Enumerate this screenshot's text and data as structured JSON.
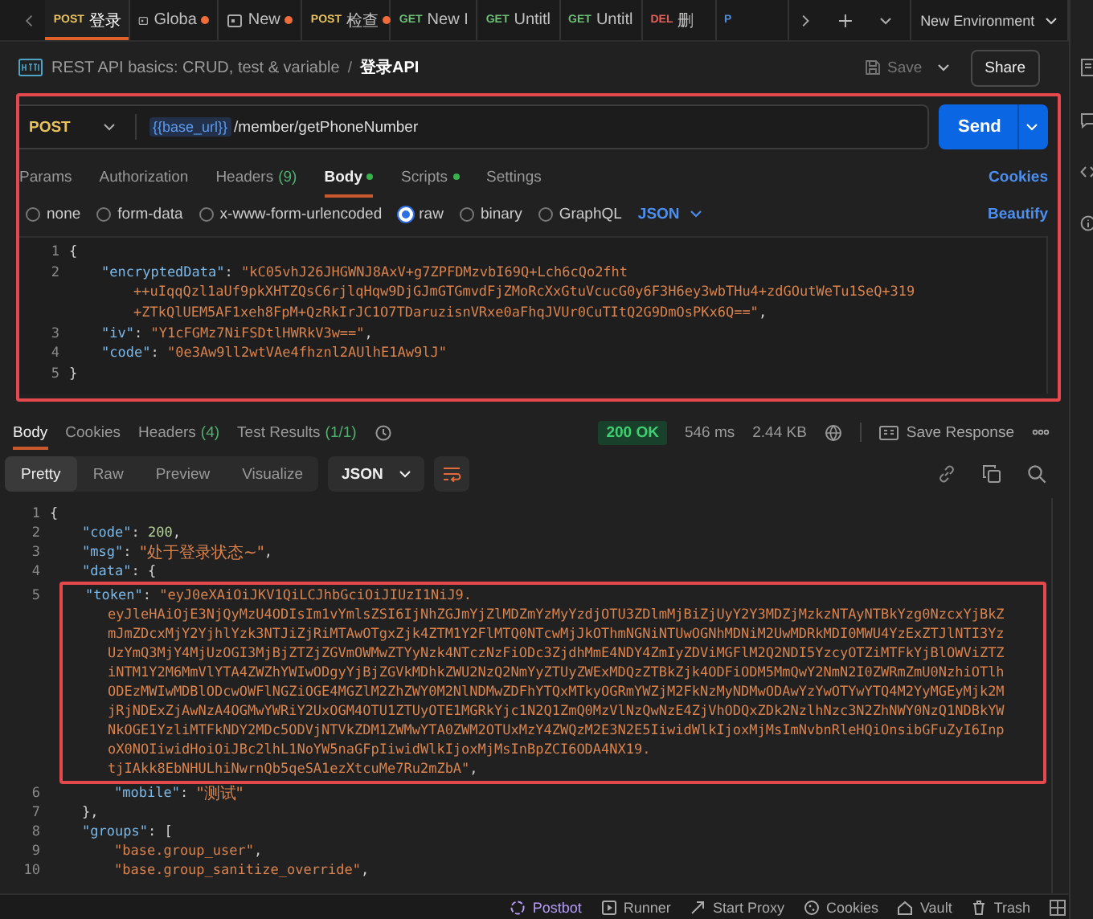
{
  "tabs": [
    {
      "kind": "request",
      "method": "POST",
      "color": "#e8c25c",
      "name": "登录",
      "unsaved": false,
      "selected": true
    },
    {
      "kind": "environment",
      "name": "Globa",
      "unsaved": true,
      "selected": false
    },
    {
      "kind": "environment",
      "name": "New",
      "unsaved": true,
      "selected": false
    },
    {
      "kind": "request",
      "method": "POST",
      "color": "#e8c25c",
      "name": "检查",
      "unsaved": true,
      "selected": false
    },
    {
      "kind": "request",
      "method": "GET",
      "color": "#6bbf74",
      "name": "New I",
      "unsaved": false,
      "selected": false
    },
    {
      "kind": "request",
      "method": "GET",
      "color": "#6bbf74",
      "name": "Untitl",
      "unsaved": false,
      "selected": false
    },
    {
      "kind": "request",
      "method": "GET",
      "color": "#6bbf74",
      "name": "Untitl",
      "unsaved": false,
      "selected": false
    },
    {
      "kind": "request",
      "method": "DEL",
      "color": "#e0605a",
      "name": "删",
      "unsaved": false,
      "selected": false
    },
    {
      "kind": "request",
      "method": "P",
      "color": "#4f8bd6",
      "unsaved": false,
      "selected": false
    }
  ],
  "environment": "New Environment",
  "breadcrumb": {
    "collection": "REST API basics: CRUD, test & variable",
    "separator": "/",
    "request": "登录API"
  },
  "save": "Save",
  "share": "Share",
  "request": {
    "method": "POST",
    "url_variable": "{{base_url}}",
    "url_path": "/member/getPhoneNumber",
    "send": "Send"
  },
  "request_tabs": [
    {
      "label": "Params",
      "selected": false,
      "dot": false
    },
    {
      "label": "Authorization",
      "selected": false,
      "dot": false
    },
    {
      "label": "Headers",
      "count": "(9)",
      "selected": false,
      "dot": false
    },
    {
      "label": "Body",
      "selected": true,
      "dot": true
    },
    {
      "label": "Scripts",
      "selected": false,
      "dot": true
    },
    {
      "label": "Settings",
      "selected": false,
      "dot": false
    }
  ],
  "cookies_link": "Cookies",
  "body_types": [
    {
      "label": "none",
      "selected": false
    },
    {
      "label": "form-data",
      "selected": false
    },
    {
      "label": "x-www-form-urlencoded",
      "selected": false
    },
    {
      "label": "raw",
      "selected": true
    },
    {
      "label": "binary",
      "selected": false
    },
    {
      "label": "GraphQL",
      "selected": false
    }
  ],
  "body_format": "JSON",
  "beautify": "Beautify",
  "request_body": [
    {
      "num": "1",
      "tokens": [
        {
          "kind": "open",
          "text": "{"
        }
      ]
    },
    {
      "num": "2",
      "tokens": [
        {
          "kind": "key",
          "text": "\"encryptedData\""
        },
        {
          "kind": "punct",
          "text": ": "
        },
        {
          "kind": "string",
          "text": "\"kC05vhJ26JHGWNJ8AxV+g7ZPFDMzvbI69Q+Lch6cQo2fht"
        }
      ],
      "wrap": [
        [
          {
            "kind": "string",
            "text": "++uIqqQzl1aUf9pkXHTZQsC6rjlqHqw9DjGJmGTGmvdFjZMoRcXxGtuVcucG0y6F3H6ey3wbTHu4+zdGOutWeTu1SeQ+319"
          }
        ],
        [
          {
            "kind": "string",
            "text": "+ZTkQlUEM5AF1xeh8FpM+QzRkIrJC1O7TDaruzisnVRxe0aFhqJVUr0CuTItQ2G9DmOsPKx6Q==\""
          },
          {
            "kind": "punct",
            "text": ","
          }
        ]
      ]
    },
    {
      "num": "3",
      "tokens": [
        {
          "kind": "key",
          "text": "\"iv\""
        },
        {
          "kind": "punct",
          "text": ": "
        },
        {
          "kind": "string",
          "text": "\"Y1cFGMz7NiFSDtlHWRkV3w==\""
        },
        {
          "kind": "punct",
          "text": ","
        }
      ]
    },
    {
      "num": "4",
      "tokens": [
        {
          "kind": "key",
          "text": "\"code\""
        },
        {
          "kind": "punct",
          "text": ": "
        },
        {
          "kind": "string",
          "text": "\"0e3Aw9ll2wtVAe4fhznl2AUlhE1Aw9lJ\""
        }
      ]
    },
    {
      "num": "5",
      "tokens": [
        {
          "kind": "close",
          "text": "}"
        }
      ]
    }
  ],
  "response": {
    "tabs": [
      {
        "label": "Body",
        "selected": true
      },
      {
        "label": "Cookies",
        "selected": false
      },
      {
        "label": "Headers",
        "count": "(4)",
        "selected": false
      },
      {
        "label": "Test Results",
        "count": "(1/1)",
        "selected": false
      }
    ],
    "status": "200 OK",
    "time": "546 ms",
    "size": "2.44 KB",
    "save_response": "Save Response",
    "views": [
      {
        "label": "Pretty",
        "selected": true
      },
      {
        "label": "Raw",
        "selected": false
      },
      {
        "label": "Preview",
        "selected": false
      },
      {
        "label": "Visualize",
        "selected": false
      }
    ],
    "format": "JSON",
    "body": [
      {
        "num": "1",
        "tokens": [
          {
            "kind": "open",
            "text": "{"
          }
        ]
      },
      {
        "num": "2",
        "tokens": [
          {
            "kind": "key",
            "text": "\"code\""
          },
          {
            "kind": "punct",
            "text": ": "
          },
          {
            "kind": "number",
            "text": "200"
          },
          {
            "kind": "punct",
            "text": ","
          }
        ]
      },
      {
        "num": "3",
        "tokens": [
          {
            "kind": "key",
            "text": "\"msg\""
          },
          {
            "kind": "punct",
            "text": ": "
          },
          {
            "kind": "string",
            "text": "\"处于登录状态~\""
          },
          {
            "kind": "punct",
            "text": ","
          }
        ]
      },
      {
        "num": "4",
        "tokens": [
          {
            "kind": "key",
            "text": "\"data\""
          },
          {
            "kind": "punct",
            "text": ": "
          },
          {
            "kind": "open",
            "text": "{"
          }
        ]
      },
      {
        "num": "5",
        "highlighted": true,
        "tokens": [
          {
            "kind": "key",
            "text": "\"token\""
          },
          {
            "kind": "punct",
            "text": ": "
          },
          {
            "kind": "string",
            "text": "\"eyJ0eXAiOiJKV1QiLCJhbGciOiJIUzI1NiJ9."
          }
        ],
        "wrap": [
          [
            {
              "kind": "string",
              "text": "eyJleHAiOjE3NjQyMzU4ODIsIm1vYmlsZSI6IjNhZGJmYjZlMDZmYzMyYzdjOTU3ZDlmMjBiZjUyY2Y3MDZjMzkzNTAyNTBkYzg0NzcxYjBkZ"
            }
          ],
          [
            {
              "kind": "string",
              "text": "mJmZDcxMjY2YjhlYzk3NTJiZjRiMTAwOTgxZjk4ZTM1Y2FlMTQ0NTcwMjJkOThmNGNiNTUwOGNhMDNiM2UwMDRkMDI0MWU4YzExZTJlNTI3Yz"
            }
          ],
          [
            {
              "kind": "string",
              "text": "UzYmQ3MjY4MjUzOGI3MjBjZTZjZGVmOWMwZTYyNzk4NTczNzFiODc3ZjdhMmE4NDY4ZmIyZDViMGFlM2Q2NDI5YzcyOTZiMTFkYjBlOWViZTZ"
            }
          ],
          [
            {
              "kind": "string",
              "text": "iNTM1Y2M6MmVlYTA4ZWZhYWIwODgyYjBjZGVkMDhkZWU2NzQ2NmYyZTUyZWExMDQzZTBkZjk4ODFiODM5MmQwY2NmN2I0ZWRmZmU0NzhiOTlh"
            }
          ],
          [
            {
              "kind": "string",
              "text": "ODEzMWIwMDBlODcwOWFlNGZiOGE4MGZlM2ZhZWY0M2NlNDMwZDFhYTQxMTkyOGRmYWZjM2FkNzMyNDMwODAwYzYwOTYwYTQ4M2YyMGEyMjk2M"
            }
          ],
          [
            {
              "kind": "string",
              "text": "jRjNDExZjAwNzA4OGMwYWRiY2UxOGM4OTU1ZTUyOTE1MGRkYjc1N2Q1ZmQ0MzVlNzQwNzE4ZjVhODQxZDk2NzlhNzc3N2ZhNWY0NzQ1NDBkYW"
            }
          ],
          [
            {
              "kind": "string",
              "text": "NkOGE1YzliMTFkNDY2MDc5ODVjNTVkZDM1ZWMwYTA0ZWM2OTUxMzY4ZWQzM2E3N2E5IiwidWlkIjoxMjMsImNvbnRleHQiOnsibGFuZyI6Inp"
            }
          ],
          [
            {
              "kind": "string",
              "text": "oX0NOIiwidHoiOiJBc2lhL1NoYW5naGFpIiwidWlkIjoxMjMsInBpZCI6ODA4NX19."
            }
          ],
          [
            {
              "kind": "string",
              "text": "tjIAkk8EbNHULhiNwrnQb5qeSA1ezXtcuMe7Ru2mZbA\""
            },
            {
              "kind": "punct",
              "text": ","
            }
          ]
        ]
      },
      {
        "num": "6",
        "tokens": [
          {
            "kind": "key",
            "text": "\"mobile\""
          },
          {
            "kind": "punct",
            "text": ": "
          },
          {
            "kind": "string",
            "text": "\"测试\""
          }
        ]
      },
      {
        "num": "7",
        "tokens": [
          {
            "kind": "close",
            "text": "},"
          }
        ]
      },
      {
        "num": "8",
        "tokens": [
          {
            "kind": "key",
            "text": "\"groups\""
          },
          {
            "kind": "punct",
            "text": ": "
          },
          {
            "kind": "open",
            "text": "["
          }
        ]
      },
      {
        "num": "9",
        "tokens": [
          {
            "kind": "string",
            "text": "\"base.group_user\""
          },
          {
            "kind": "punct",
            "text": ","
          }
        ]
      },
      {
        "num": "10",
        "tokens": [
          {
            "kind": "string",
            "text": "\"base.group_sanitize_override\""
          },
          {
            "kind": "punct",
            "text": ","
          }
        ]
      }
    ]
  },
  "status_bar": [
    {
      "kind": "postbot",
      "label": "Postbot"
    },
    {
      "kind": "runner",
      "label": "Runner"
    },
    {
      "kind": "proxy",
      "label": "Start Proxy"
    },
    {
      "kind": "cookies",
      "label": "Cookies"
    },
    {
      "kind": "vault",
      "label": "Vault"
    },
    {
      "kind": "trash",
      "label": "Trash"
    }
  ]
}
